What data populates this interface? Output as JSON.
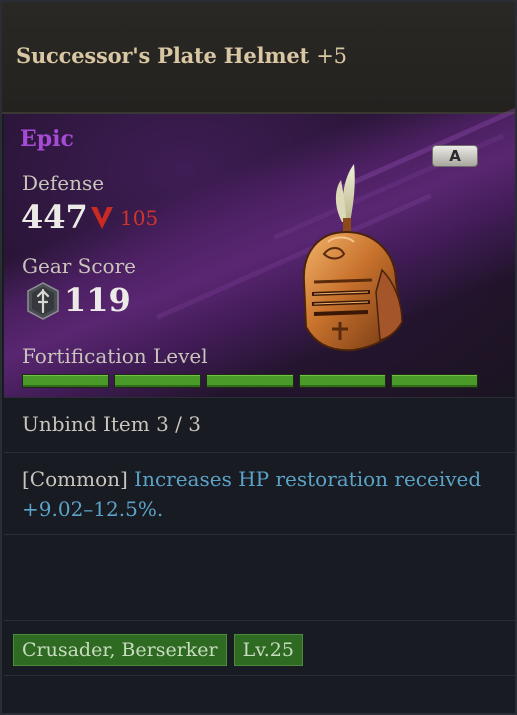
{
  "item": {
    "name": "Successor's Plate Helmet",
    "upgrade": "+5",
    "rarity": "Epic",
    "rarity_color": "#a54bd6",
    "grade": "A",
    "icon": "plate-helmet-icon"
  },
  "stats": {
    "defense_label": "Defense",
    "defense_value": "447",
    "defense_delta": "105",
    "defense_delta_direction": "down",
    "gear_score_label": "Gear Score",
    "gear_score_value": "119",
    "gear_score_icon": "gear-score-shield-icon"
  },
  "fortification": {
    "label": "Fortification Level",
    "filled": 5,
    "total": 5,
    "color": "#4a9a2a"
  },
  "unbind": {
    "text": "Unbind Item 3 / 3"
  },
  "effect": {
    "prefix": "[Common]",
    "text": " Increases HP restoration received",
    "value": " +9.02–12.5%."
  },
  "tags": {
    "classes": "Crusader, Berserker",
    "level": "Lv.25"
  }
}
